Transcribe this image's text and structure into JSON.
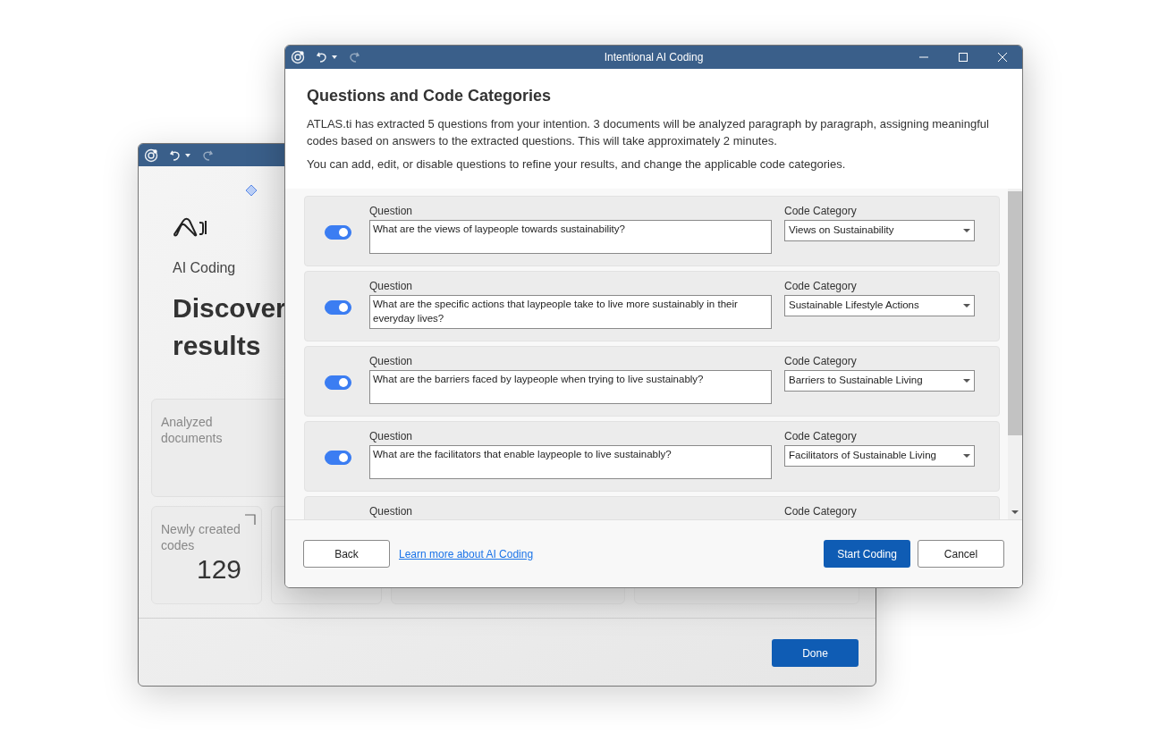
{
  "background_window": {
    "subtitle": "AI Coding",
    "heading": "Discover results",
    "cards": [
      {
        "title": "Analyzed documents"
      },
      {
        "title": "Newly created codes",
        "value": "129"
      }
    ],
    "done_button": "Done"
  },
  "dialog": {
    "title": "Intentional AI Coding",
    "heading": "Questions and Code Categories",
    "paragraphs": [
      "ATLAS.ti has extracted 5 questions from your intention. 3 documents will be analyzed paragraph by paragraph, assigning meaningful codes based on answers to the extracted questions. This will take approximately 2 minutes.",
      "You can add, edit, or disable questions to refine your results, and change the applicable code categories."
    ],
    "questions": [
      {
        "question_label": "Question",
        "category_label": "Code Category",
        "on": true,
        "text": "What are the views of laypeople towards sustainability?",
        "category": "Views on Sustainability"
      },
      {
        "question_label": "Question",
        "category_label": "Code Category",
        "on": true,
        "text": "What are the specific actions that laypeople take to live more sustainably in their everyday lives?",
        "category": "Sustainable Lifestyle Actions"
      },
      {
        "question_label": "Question",
        "category_label": "Code Category",
        "on": true,
        "text": "What are the barriers faced by laypeople when trying to live sustainably?",
        "category": "Barriers to Sustainable Living"
      },
      {
        "question_label": "Question",
        "category_label": "Code Category",
        "on": true,
        "text": "What are the facilitators that enable laypeople to live sustainably?",
        "category": "Facilitators of Sustainable Living"
      },
      {
        "question_label": "Question",
        "category_label": "Code Category"
      }
    ],
    "back_button": "Back",
    "learn_link": "Learn more about AI Coding",
    "start_button": "Start Coding",
    "cancel_button": "Cancel"
  }
}
